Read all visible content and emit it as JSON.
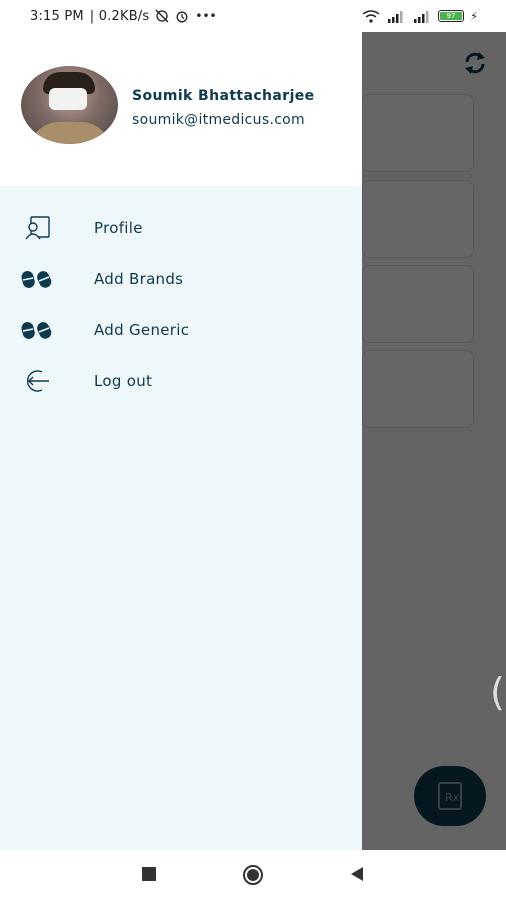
{
  "status_bar": {
    "time": "3:15 PM",
    "net_speed": "| 0.2KB/s",
    "battery": "97",
    "icons": [
      "sync-disabled-icon",
      "alarm-icon",
      "more-icon",
      "wifi-icon",
      "signal-icon",
      "signal-icon",
      "battery-icon",
      "charging-icon"
    ]
  },
  "drawer": {
    "user_name": "Soumik Bhattacharjee",
    "user_email": "soumik@itmedicus.com",
    "menu": [
      {
        "label": "Profile",
        "icon": "profile-icon"
      },
      {
        "label": "Add Brands",
        "icon": "pills-icon"
      },
      {
        "label": "Add Generic",
        "icon": "pills-icon"
      },
      {
        "label": "Log out",
        "icon": "logout-icon"
      }
    ]
  },
  "app": {
    "fab_icon": "prescription-icon",
    "toolbar_icon": "sync-icon"
  },
  "nav": {
    "buttons": [
      "recents-button",
      "home-button",
      "back-button"
    ]
  },
  "colors": {
    "primary": "#0f3a4e",
    "drawer_bg": "#eef8fb",
    "scrim": "rgba(0,0,0,0.6)"
  }
}
